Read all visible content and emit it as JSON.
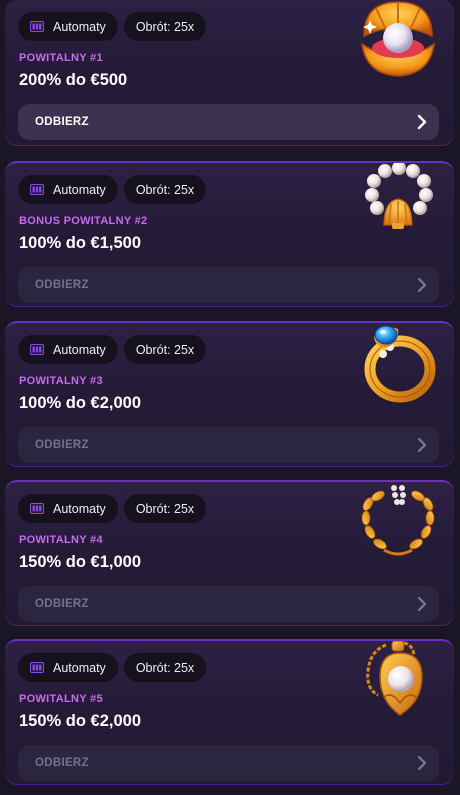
{
  "cards": [
    {
      "tag_category": "Automaty",
      "tag_wager": "Obrót: 25x",
      "label": "POWITALNY #1",
      "amount": "200% do €500",
      "claim_label": "ODBIERZ",
      "claim_state": "active",
      "icon": "pearl-shell-icon"
    },
    {
      "tag_category": "Automaty",
      "tag_wager": "Obrót: 25x",
      "label": "BONUS POWITALNY #2",
      "amount": "100% do €1,500",
      "claim_label": "ODBIERZ",
      "claim_state": "disabled",
      "icon": "pearl-bracelet-icon"
    },
    {
      "tag_category": "Automaty",
      "tag_wager": "Obrót: 25x",
      "label": "POWITALNY #3",
      "amount": "100% do €2,000",
      "claim_label": "ODBIERZ",
      "claim_state": "disabled",
      "icon": "sapphire-ring-icon"
    },
    {
      "tag_category": "Automaty",
      "tag_wager": "Obrót: 25x",
      "label": "POWITALNY #4",
      "amount": "150% do €1,000",
      "claim_label": "ODBIERZ",
      "claim_state": "disabled",
      "icon": "golden-laurel-icon"
    },
    {
      "tag_category": "Automaty",
      "tag_wager": "Obrót: 25x",
      "label": "POWITALNY #5",
      "amount": "150% do €2,000",
      "claim_label": "ODBIERZ",
      "claim_state": "disabled",
      "icon": "pearl-pendant-icon"
    }
  ],
  "colors": {
    "accent_label": "#c96bf0",
    "card_border": "#6a2fc9",
    "tag_bg": "#15111d"
  }
}
